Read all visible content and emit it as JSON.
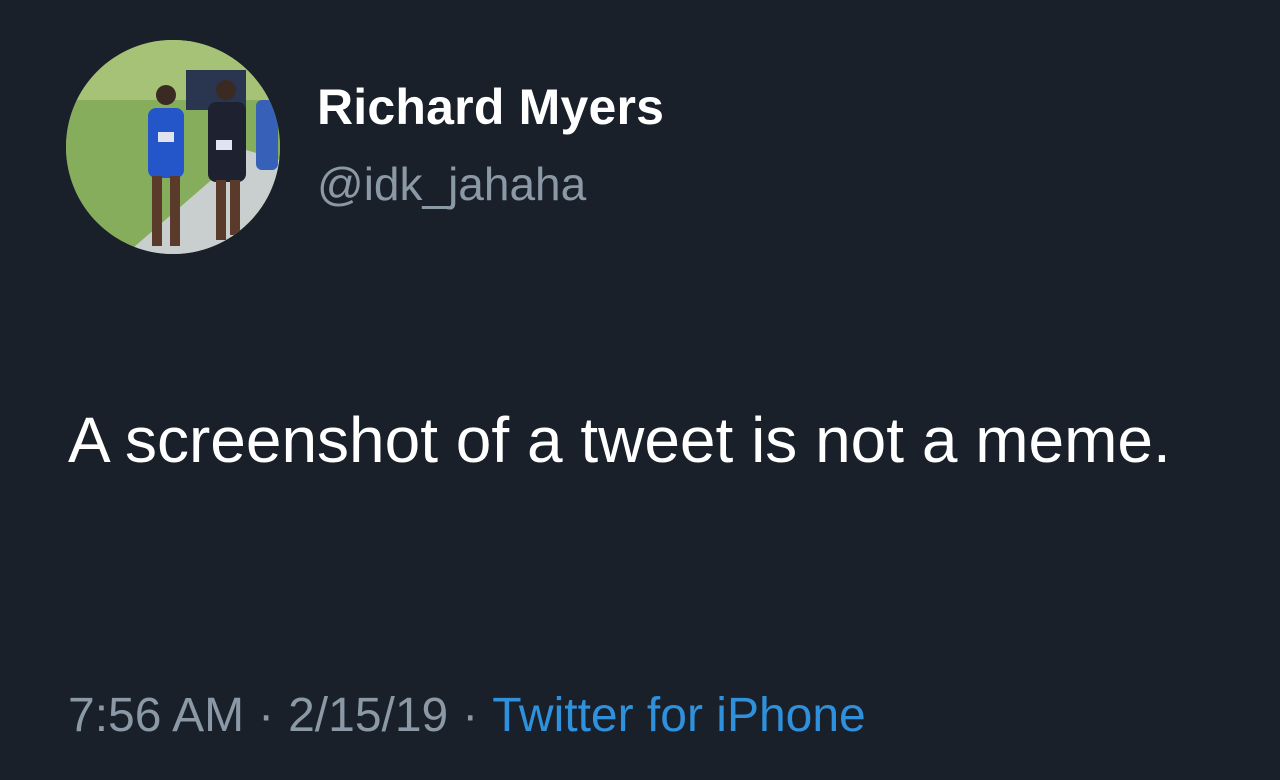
{
  "tweet": {
    "author": {
      "display_name": "Richard Myers",
      "handle": "@idk_jahaha",
      "avatar_description_icon": "profile-photo-runners"
    },
    "text": "A screenshot of a tweet is not a meme.",
    "meta": {
      "time": "7:56 AM",
      "date": "2/15/19",
      "separator": "·",
      "source": "Twitter for iPhone"
    }
  },
  "colors": {
    "background": "#19202a",
    "primary_text": "#ffffff",
    "secondary_text": "#8b98a5",
    "link": "#2f91dc"
  }
}
